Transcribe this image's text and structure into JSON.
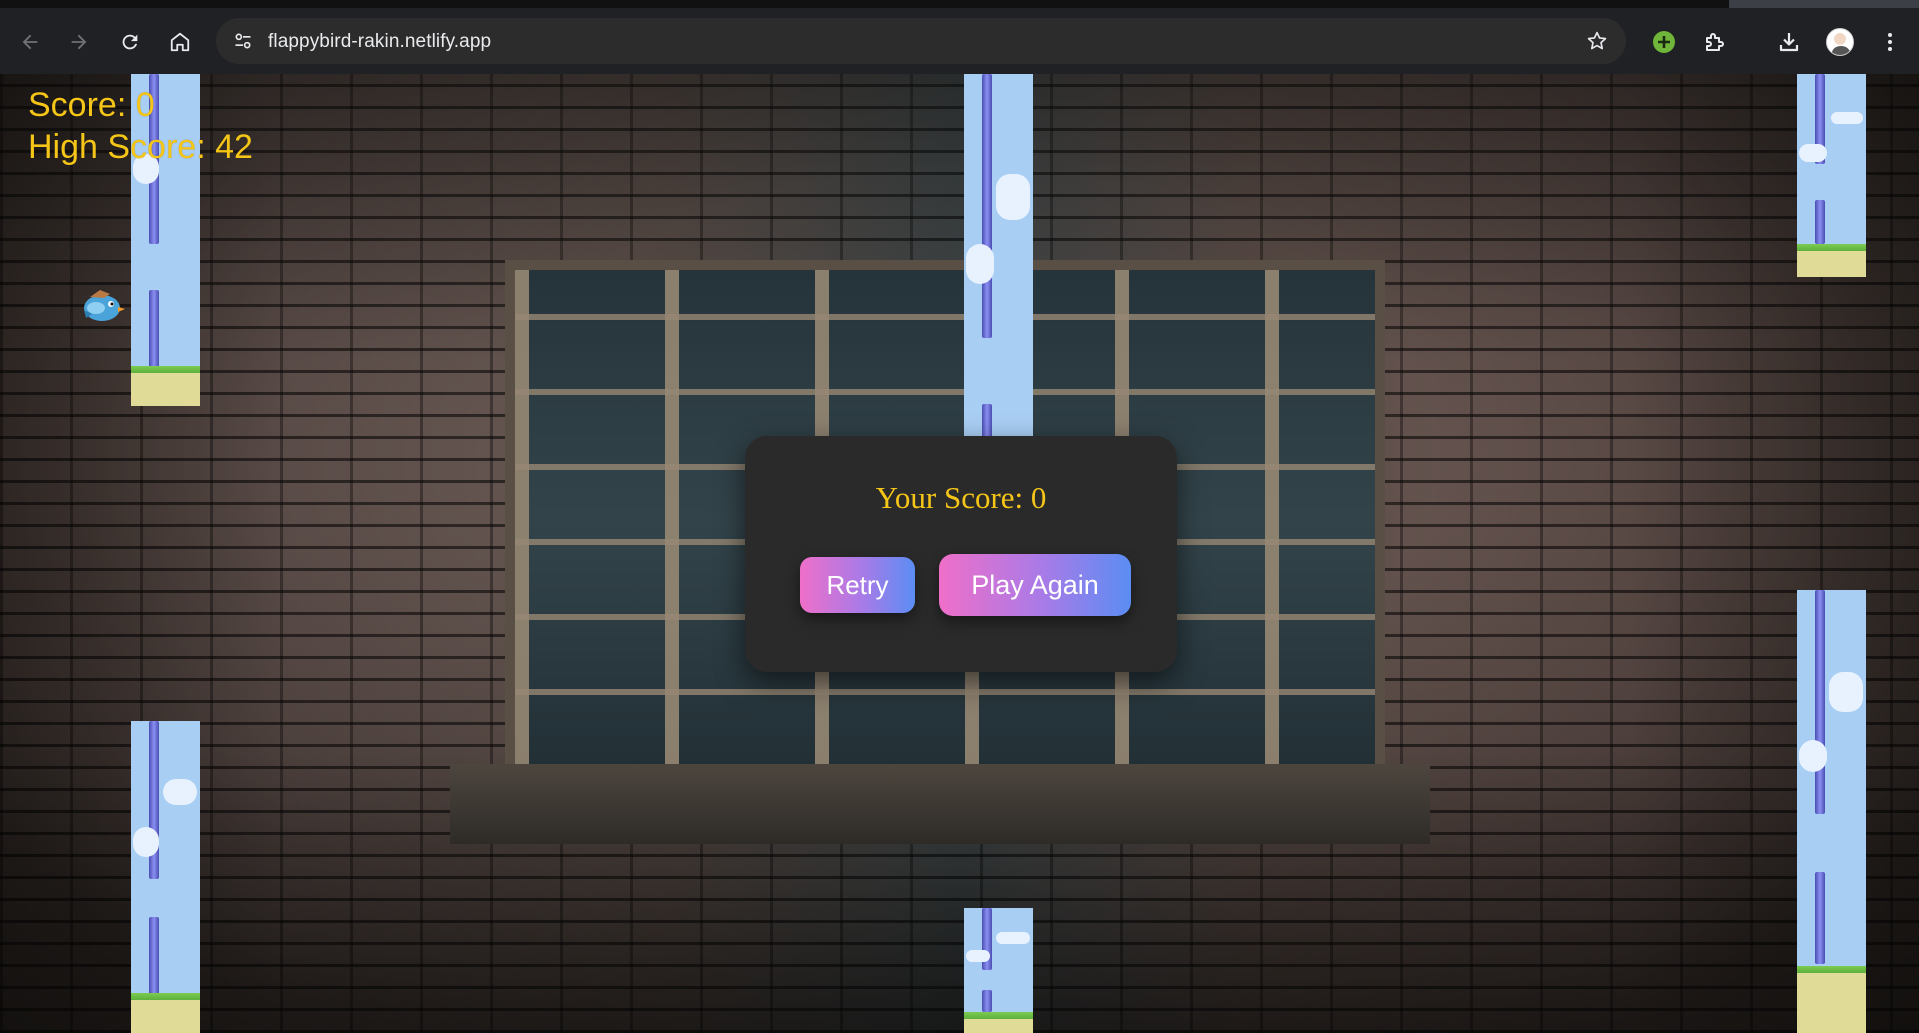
{
  "browser": {
    "url": "flappybird-rakin.netlify.app"
  },
  "hud": {
    "score_label": "Score: 0",
    "high_score_label": "High Score: 42"
  },
  "modal": {
    "title": "Your Score: 0",
    "retry_label": "Retry",
    "play_again_label": "Play Again"
  },
  "colors": {
    "score_text": "#f5c518",
    "modal_bg": "#2a2a2a",
    "button_gradient_start": "#ef6fc9",
    "button_gradient_end": "#5b8df3",
    "pipe_bg": "#a9cef4"
  }
}
